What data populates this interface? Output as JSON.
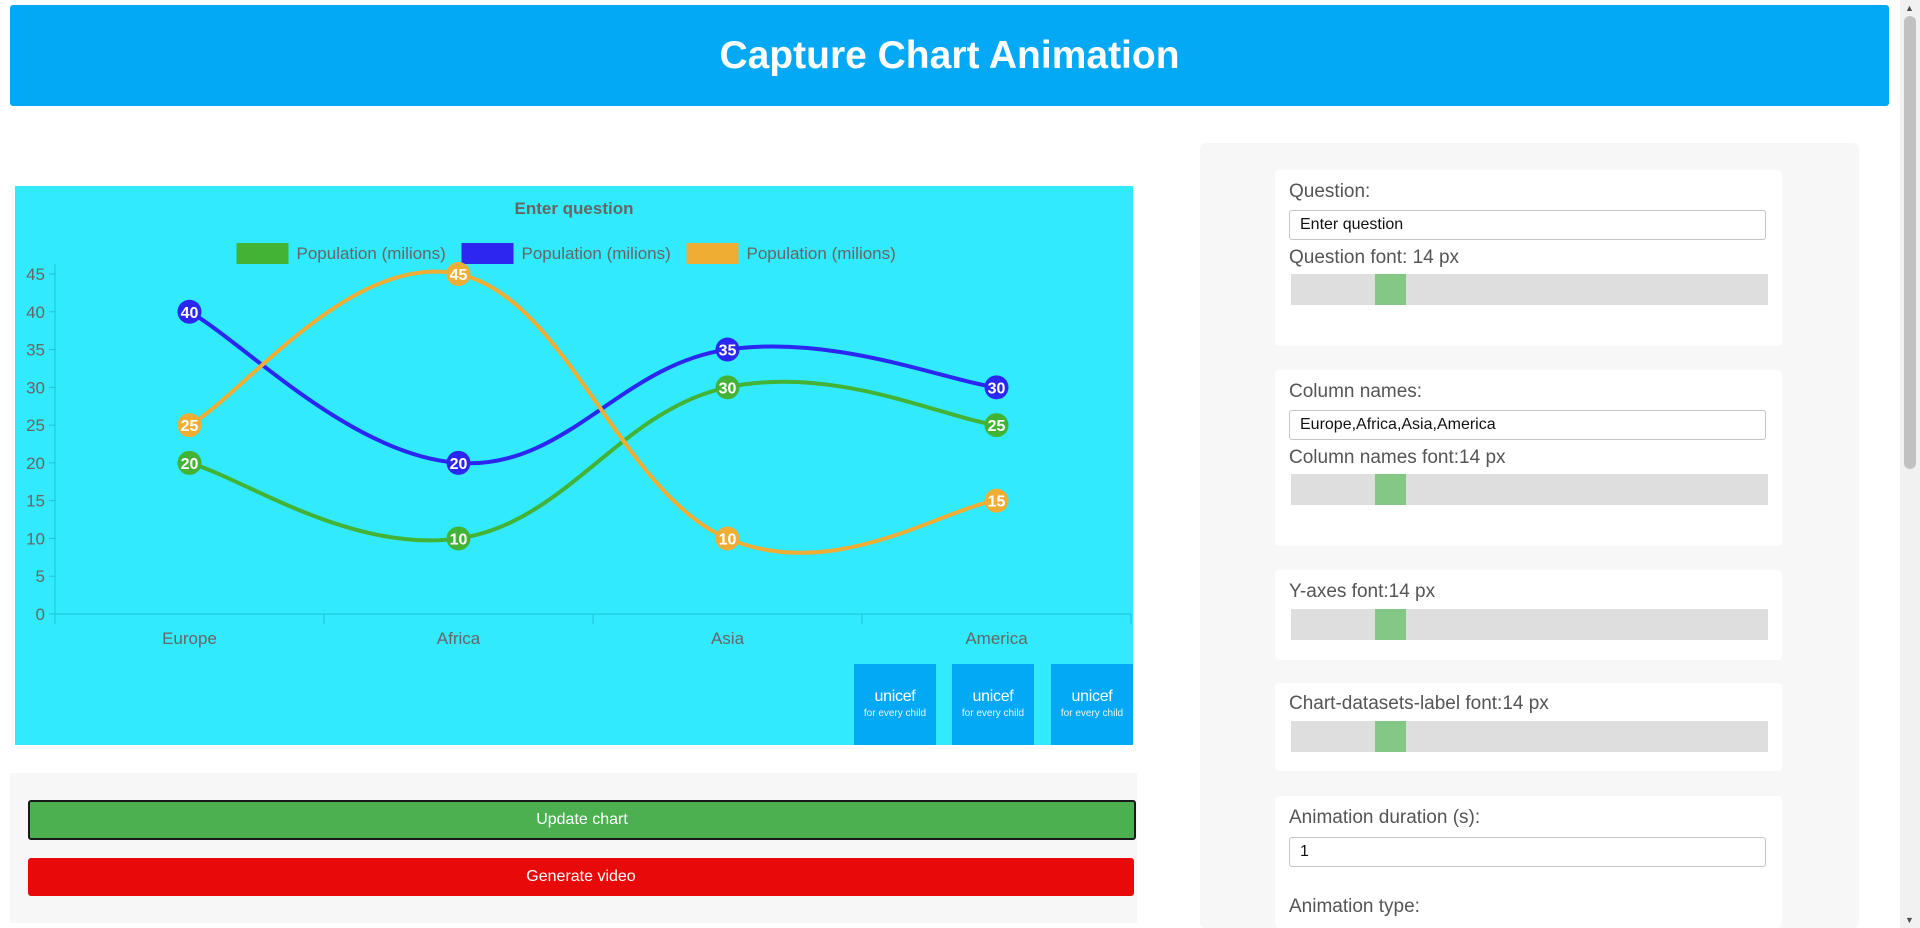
{
  "header": {
    "title": "Capture Chart Animation"
  },
  "chart_data": {
    "type": "line",
    "title": "Enter question",
    "categories": [
      "Europe",
      "Africa",
      "Asia",
      "America"
    ],
    "series": [
      {
        "name": "Population (milions)",
        "color": "#43b336",
        "values": [
          20,
          10,
          30,
          25
        ]
      },
      {
        "name": "Population (milions)",
        "color": "#2b26f0",
        "values": [
          40,
          20,
          35,
          30
        ]
      },
      {
        "name": "Population (milions)",
        "color": "#f0ad33",
        "values": [
          25,
          45,
          10,
          15
        ]
      }
    ],
    "yticks": [
      "0",
      "5",
      "10",
      "15",
      "20",
      "25",
      "30",
      "35",
      "40",
      "45"
    ],
    "ylim": [
      0,
      45
    ],
    "legend_position": "top",
    "background": "#32eafd",
    "line_style": "smooth"
  },
  "logos": [
    {
      "line1": "unicef",
      "line2": "for every child"
    },
    {
      "line1": "unicef",
      "line2": "for every child"
    },
    {
      "line1": "unicef",
      "line2": "for every child"
    }
  ],
  "buttons": {
    "update": "Update chart",
    "generate": "Generate video"
  },
  "settings": {
    "question_label": "Question:",
    "question_value": "Enter question",
    "question_font_label": "Question font: 14 px",
    "question_font_value": 14,
    "column_names_label": "Column names:",
    "column_names_value": "Europe,Africa,Asia,America",
    "column_names_font_label": "Column names font:14 px",
    "column_names_font_value": 14,
    "yaxes_font_label": "Y-axes font:14 px",
    "yaxes_font_value": 14,
    "datasets_font_label": "Chart-datasets-label font:14 px",
    "datasets_font_value": 14,
    "animation_duration_label": "Animation duration (s):",
    "animation_duration_value": "1",
    "animation_type_label": "Animation type:"
  },
  "colors": {
    "header": "#03a9f4",
    "update_button": "#4caf50",
    "generate_button": "#e80a0a",
    "slider_thumb": "#83c884"
  }
}
